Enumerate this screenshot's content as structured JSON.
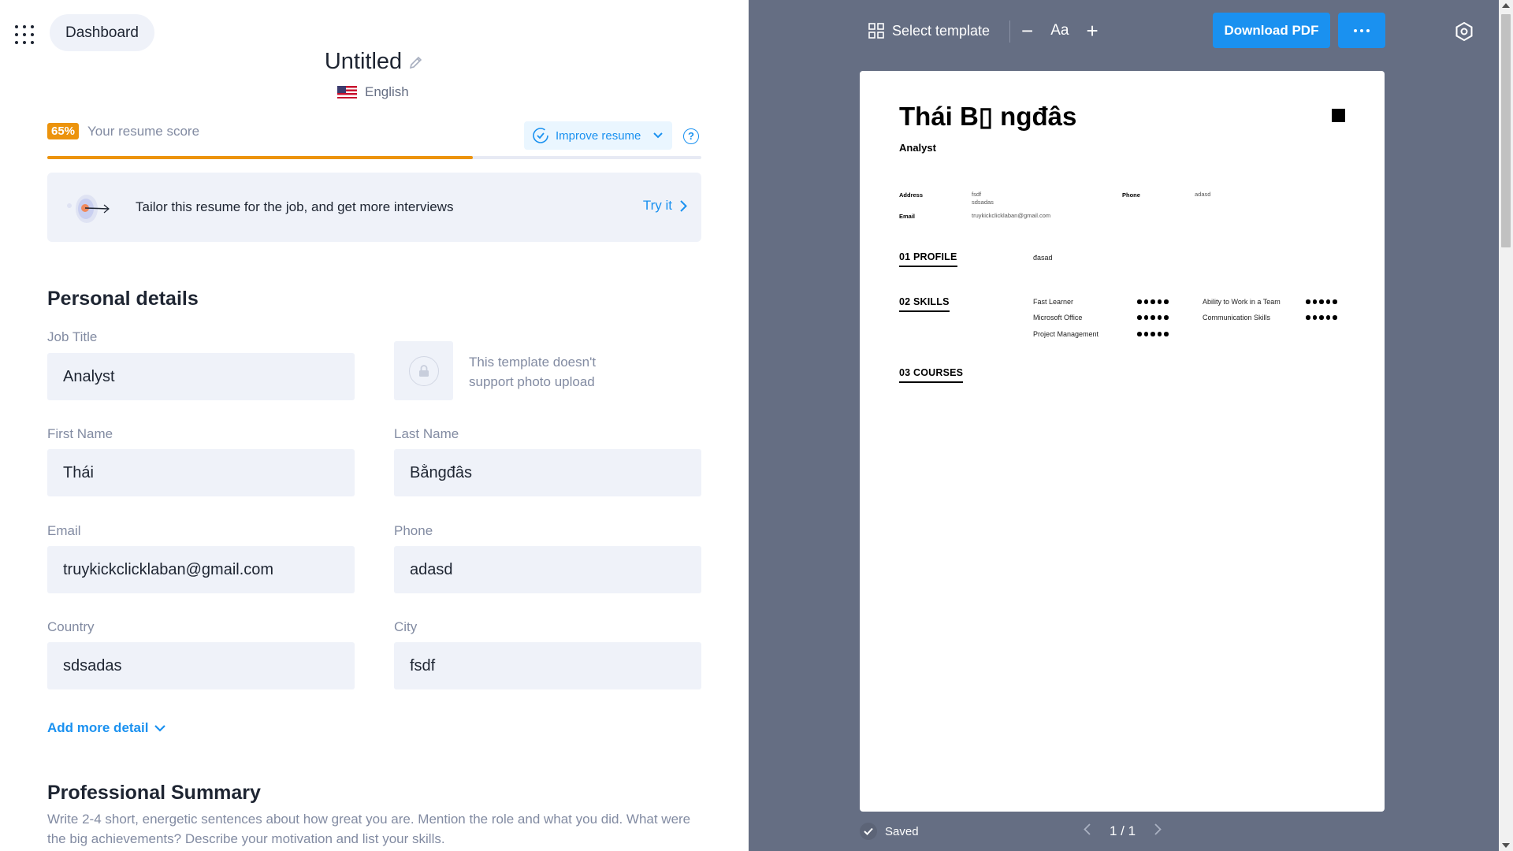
{
  "header": {
    "apps_icon": "grid-dots-icon",
    "dashboard_label": "Dashboard"
  },
  "document": {
    "title": "Untitled",
    "language": "English"
  },
  "score": {
    "percent_label": "65%",
    "percent": 65,
    "label": "Your resume score",
    "improve_label": "Improve resume",
    "help_symbol": "?",
    "color": "#ec930c"
  },
  "tailor": {
    "text": "Tailor this resume for the job, and get more interviews",
    "action": "Try it"
  },
  "personal": {
    "section_title": "Personal details",
    "job_title_label": "Job Title",
    "job_title_value": "Analyst",
    "photo_note": "This template doesn't support photo upload",
    "first_name_label": "First Name",
    "first_name_value": "Thái",
    "last_name_label": "Last Name",
    "last_name_value": "Bằngđâs",
    "email_label": "Email",
    "email_value": "truykickclicklaban@gmail.com",
    "phone_label": "Phone",
    "phone_value": "adasd",
    "country_label": "Country",
    "country_value": "sdsadas",
    "city_label": "City",
    "city_value": "fsdf",
    "add_more_label": "Add more detail"
  },
  "summary": {
    "section_title": "Professional Summary",
    "hint": "Write 2-4 short, energetic sentences about how great you are. Mention the role and what you did. What were the big achievements? Describe your motivation and list your skills."
  },
  "toolbar": {
    "select_template_label": "Select template",
    "font_label": "Aa",
    "minus_symbol": "−",
    "plus_symbol": "+",
    "download_label": "Download PDF",
    "accent": "#1a91f0"
  },
  "preview": {
    "name": "Thái B▯ ngđâs",
    "role": "Analyst",
    "address_label": "Address",
    "address_line1": "fsdf",
    "address_line2": "sdsadas",
    "phone_label": "Phone",
    "phone_value": "adasd",
    "email_label": "Email",
    "email_value": "truykickclicklaban@gmail.com",
    "profile_heading": "01  PROFILE",
    "profile_text": "đasad",
    "skills_heading": "02  SKILLS",
    "skills": [
      {
        "name": "Fast Learner",
        "level": 5
      },
      {
        "name": "Ability to Work in a Team",
        "level": 5
      },
      {
        "name": "Microsoft Office",
        "level": 5
      },
      {
        "name": "Communication Skills",
        "level": 5
      },
      {
        "name": "Project Management",
        "level": 5
      }
    ],
    "courses_heading": "03  COURSES"
  },
  "footer": {
    "saved_label": "Saved",
    "page_indicator": "1 / 1"
  }
}
